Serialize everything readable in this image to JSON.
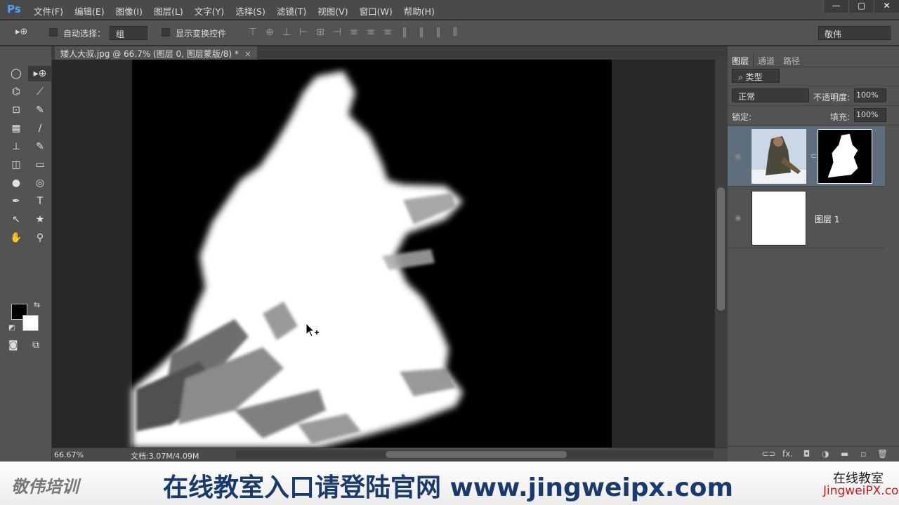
{
  "app": {
    "logo": "Ps"
  },
  "menu": [
    "文件(F)",
    "编辑(E)",
    "图像(I)",
    "图层(L)",
    "文字(Y)",
    "选择(S)",
    "滤镜(T)",
    "视图(V)",
    "窗口(W)",
    "帮助(H)"
  ],
  "window_controls": [
    "—",
    "▢",
    "✕"
  ],
  "options": {
    "tool_glyph": "▸⊕",
    "auto_select_label": "自动选择：",
    "auto_select_value": "组",
    "show_transform_label": "显示变换控件",
    "align_icons": [
      "⊤",
      "⊕",
      "⊥",
      "⊢",
      "⊞",
      "⊣",
      "≡",
      "≡",
      "≡",
      "‖",
      "‖",
      "‖",
      "⫼"
    ],
    "workspace": "敬伟"
  },
  "document": {
    "tab_title": "矮人大叔.jpg @ 66.7% (图层 0, 图层蒙版/8) *",
    "close": "×"
  },
  "tools": [
    "◯",
    "▸⊕",
    "⌬",
    "⟋",
    "⊡",
    "✎",
    "▦",
    "∕",
    "⊥",
    "✎",
    "◫",
    "▭",
    "●",
    "◎",
    "✒",
    "T",
    "↖",
    "★",
    "✋",
    "⚲"
  ],
  "swatches": {
    "fg": "#000000",
    "bg": "#ffffff",
    "swap": "⇆",
    "default": "◩",
    "quickmask": "◙",
    "screen": "⧉"
  },
  "status": {
    "zoom": "66.67%",
    "doc": "文档:3.07M/4.09M"
  },
  "panel": {
    "tabs": [
      "图层",
      "通道",
      "路径"
    ],
    "filter": "⌕ 类型",
    "blend_mode": "正常",
    "opacity_label": "不透明度:",
    "opacity": "100%",
    "lock_label": "锁定:",
    "fill_label": "填充:",
    "fill": "100%",
    "layers": [
      {
        "name": "",
        "has_mask": true
      },
      {
        "name": "图层 1",
        "has_mask": false
      }
    ],
    "footer_icons": [
      "⊂⊃",
      "fx.",
      "◘",
      "◑",
      "▬",
      "▫",
      "🗑"
    ]
  },
  "banner": {
    "left_brand": "敬伟培训",
    "slogan": "在线教室入口请登陆官网 www.jingweipx.com",
    "right_title": "在线教室",
    "right_url": "JingweiPX.com"
  }
}
